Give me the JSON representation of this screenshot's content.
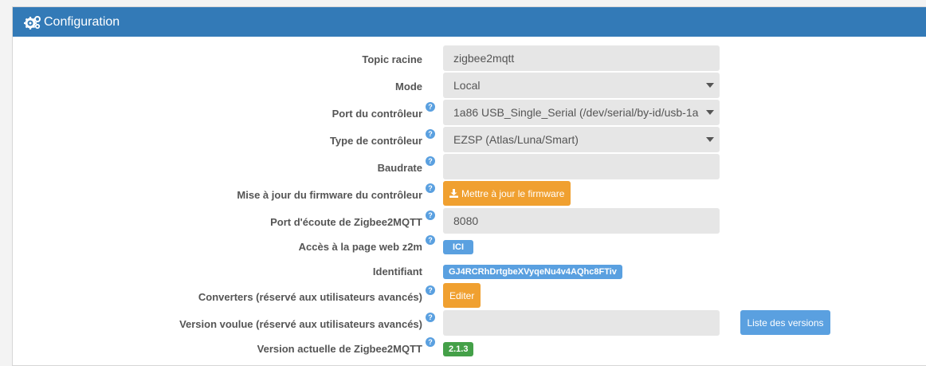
{
  "panel": {
    "title": "Configuration",
    "icon": "gears-icon",
    "header_color": "#337ab7"
  },
  "form": {
    "topic_racine": {
      "label": "Topic racine",
      "value": "zigbee2mqtt"
    },
    "mode": {
      "label": "Mode",
      "value": "Local"
    },
    "port_controleur": {
      "label": "Port du contrôleur",
      "value": "1a86 USB_Single_Serial (/dev/serial/by-id/usb-1a"
    },
    "type_controleur": {
      "label": "Type de contrôleur",
      "value": "EZSP (Atlas/Luna/Smart)"
    },
    "baudrate": {
      "label": "Baudrate",
      "value": ""
    },
    "firmware": {
      "label": "Mise à jour du firmware du contrôleur",
      "button": "Mettre à jour le firmware"
    },
    "port_ecoute": {
      "label": "Port d'écoute de Zigbee2MQTT",
      "value": "8080"
    },
    "page_web": {
      "label": "Accès à la page web z2m",
      "badge": "ICI"
    },
    "identifiant": {
      "label": "Identifiant",
      "badge": "GJ4RCRhDrtgbeXVyqeNu4v4AQhc8FTiv"
    },
    "converters": {
      "label": "Converters (réservé aux utilisateurs avancés)",
      "button": "Editer"
    },
    "version_voulue": {
      "label": "Version voulue (réservé aux utilisateurs avancés)",
      "value": "",
      "button": "Liste des versions"
    },
    "version_actuelle": {
      "label": "Version actuelle de Zigbee2MQTT",
      "badge": "2.1.3"
    }
  },
  "help_icon": "?",
  "colors": {
    "orange": "#f0a030",
    "blue": "#5aa0e0",
    "green": "#44a048"
  }
}
